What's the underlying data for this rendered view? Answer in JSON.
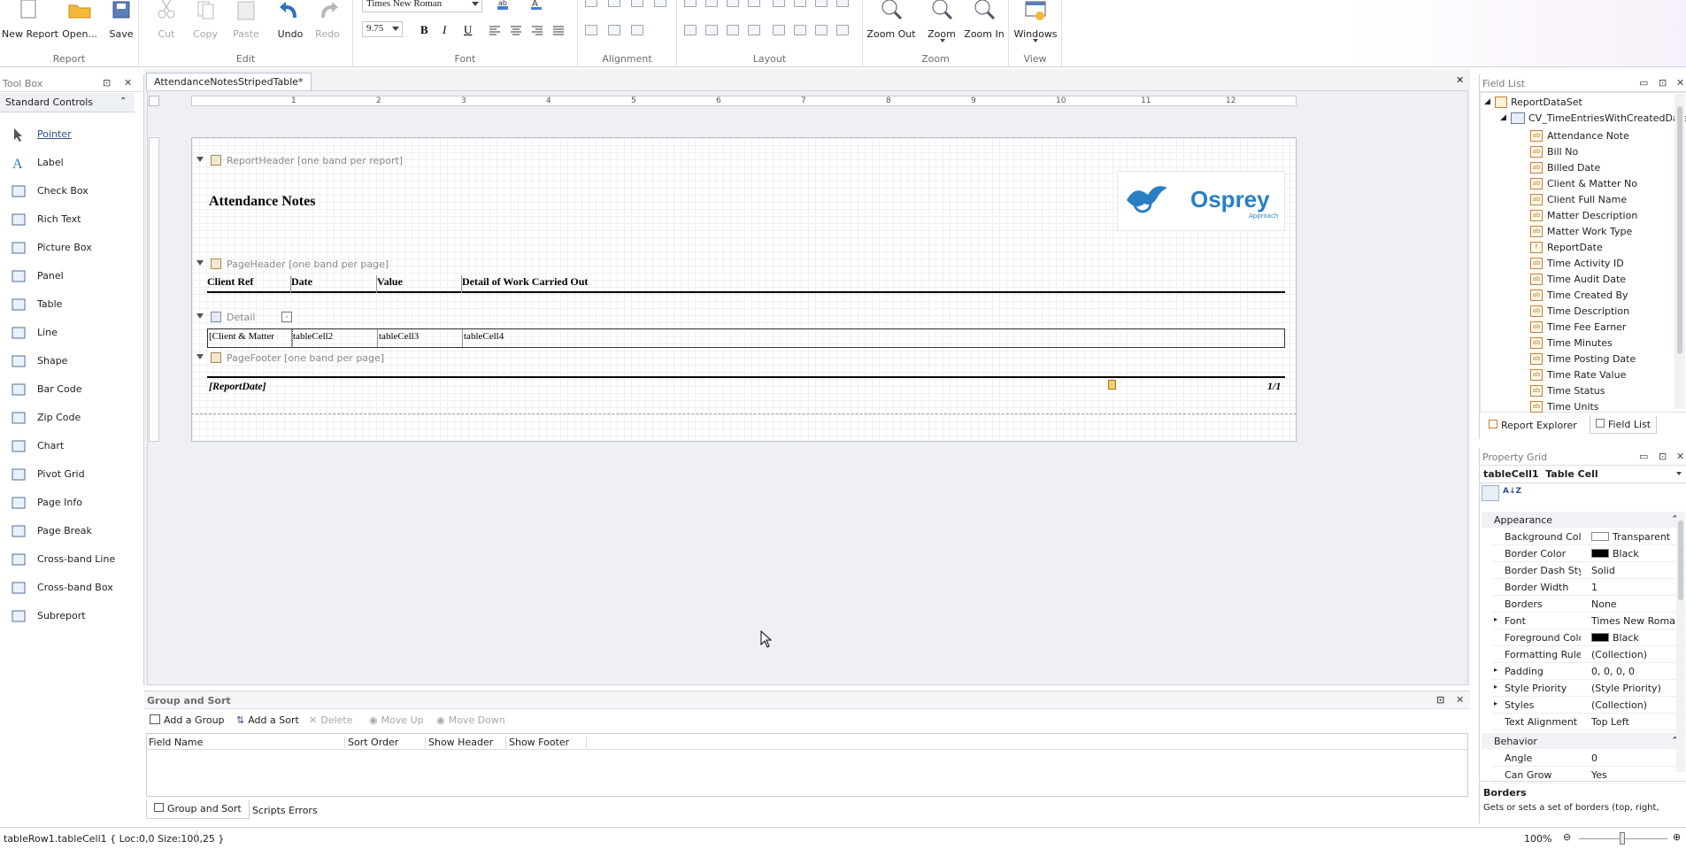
{
  "ribbon": {
    "report": {
      "group": "Report",
      "new_report": "New Report",
      "open": "Open...",
      "save": "Save"
    },
    "edit": {
      "group": "Edit",
      "cut": "Cut",
      "copy": "Copy",
      "paste": "Paste",
      "undo": "Undo",
      "redo": "Redo"
    },
    "font": {
      "group": "Font",
      "family": "Times New Roman",
      "size": "9.75",
      "bold": "B",
      "italic": "I",
      "underline": "U"
    },
    "alignment": {
      "group": "Alignment"
    },
    "layout": {
      "group": "Layout"
    },
    "zoom": {
      "group": "Zoom",
      "zoom_out": "Zoom Out",
      "zoom": "Zoom",
      "zoom_in": "Zoom In"
    },
    "view": {
      "group": "View",
      "windows": "Windows"
    }
  },
  "toolbox": {
    "title": "Tool Box",
    "category": "Standard Controls",
    "items": [
      "Pointer",
      "Label",
      "Check Box",
      "Rich Text",
      "Picture Box",
      "Panel",
      "Table",
      "Line",
      "Shape",
      "Bar Code",
      "Zip Code",
      "Chart",
      "Pivot Grid",
      "Page Info",
      "Page Break",
      "Cross-band Line",
      "Cross-band Box",
      "Subreport"
    ]
  },
  "document": {
    "tab": "AttendanceNotesStripedTable*",
    "ruler": [
      "1",
      "2",
      "3",
      "4",
      "5",
      "6",
      "7",
      "8",
      "9",
      "10",
      "11",
      "12"
    ],
    "bands": {
      "report_header": "ReportHeader [one band per report]",
      "page_header": "PageHeader [one band per page]",
      "detail": "Detail",
      "page_footer": "PageFooter [one band per page]"
    },
    "title": "Attendance Notes",
    "logo_text": "Osprey",
    "logo_sub": "Approach",
    "columns": [
      "Client Ref",
      "Date",
      "Value",
      "Detail of Work Carried Out"
    ],
    "cells": [
      "[Client & Matter",
      "tableCell2",
      "tableCell3",
      "tableCell4"
    ],
    "footer_left": "[ReportDate]",
    "footer_right": "1/1"
  },
  "fieldlist": {
    "title": "Field List",
    "root": "ReportDataSet",
    "table": "CV_TimeEntriesWithCreatedDate",
    "fields": [
      "Attendance Note",
      "Bill No",
      "Billed Date",
      "Client & Matter No",
      "Client Full Name",
      "Matter Description",
      "Matter Work Type",
      "ReportDate",
      "Time Activity ID",
      "Time Audit Date",
      "Time Created By",
      "Time Description",
      "Time Fee Earner",
      "Time Minutes",
      "Time Posting Date",
      "Time Rate Value",
      "Time Status",
      "Time Units"
    ],
    "tabs": [
      "Report Explorer",
      "Field List"
    ]
  },
  "propgrid": {
    "title": "Property Grid",
    "object": "tableCell1",
    "object_type": "Table Cell",
    "cat_appearance": "Appearance",
    "cat_behavior": "Behavior",
    "rows": [
      {
        "name": "Background Colo",
        "value": "Transparent",
        "swatch": "#ffffff"
      },
      {
        "name": "Border Color",
        "value": "Black",
        "swatch": "#000000"
      },
      {
        "name": "Border Dash Sty",
        "value": "Solid"
      },
      {
        "name": "Border Width",
        "value": "1"
      },
      {
        "name": "Borders",
        "value": "None"
      },
      {
        "name": "Font",
        "value": "Times New Roman,..."
      },
      {
        "name": "Foreground Colo",
        "value": "Black",
        "swatch": "#000000"
      },
      {
        "name": "Formatting Rule",
        "value": "(Collection)"
      },
      {
        "name": "Padding",
        "value": "0, 0, 0, 0"
      },
      {
        "name": "Style Priority",
        "value": "(Style Priority)"
      },
      {
        "name": "Styles",
        "value": "(Collection)"
      },
      {
        "name": "Text Alignment",
        "value": "Top Left"
      }
    ],
    "behavior_rows": [
      {
        "name": "Angle",
        "value": "0"
      },
      {
        "name": "Can Grow",
        "value": "Yes"
      }
    ],
    "desc_title": "Borders",
    "desc_text": "Gets or sets a set of borders (top, right,"
  },
  "groupsort": {
    "title": "Group and Sort",
    "add_group": "Add a Group",
    "add_sort": "Add a Sort",
    "delete": "Delete",
    "move_up": "Move Up",
    "move_down": "Move Down",
    "columns": [
      "Field Name",
      "Sort Order",
      "Show Header",
      "Show Footer"
    ],
    "tabs": [
      "Group and Sort",
      "Scripts Errors"
    ]
  },
  "status": {
    "text": "tableRow1.tableCell1 { Loc:0,0 Size:100,25 }",
    "zoom": "100%"
  }
}
